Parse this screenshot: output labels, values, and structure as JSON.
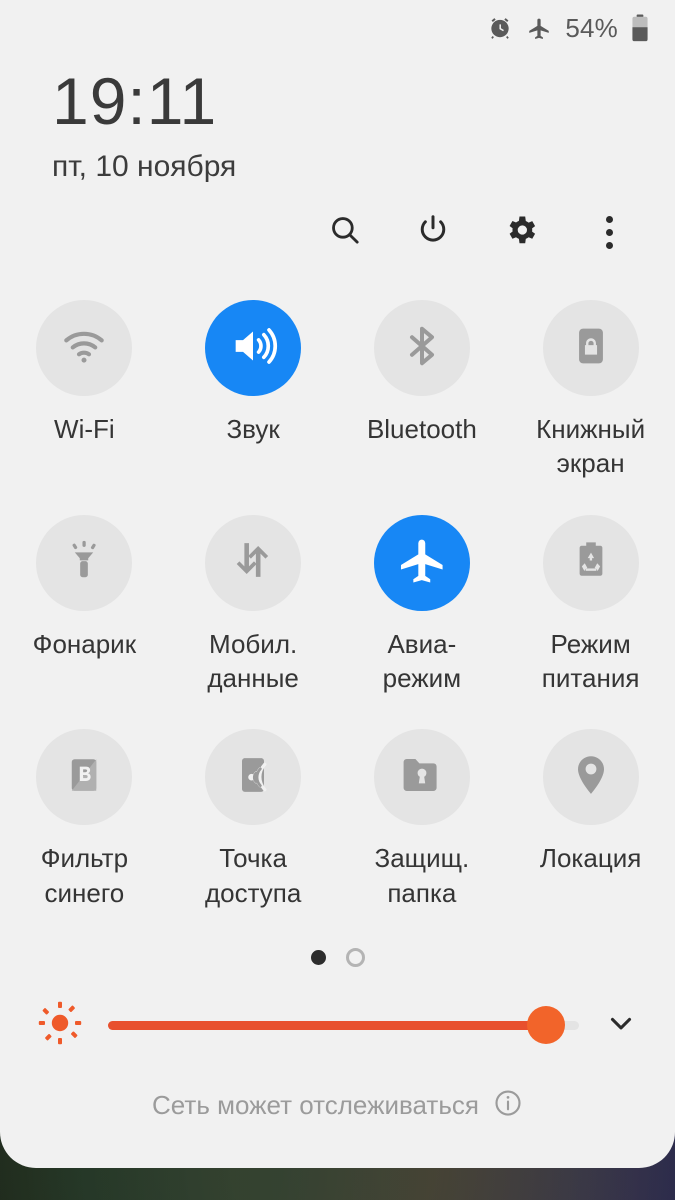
{
  "statusbar": {
    "alarm_icon": "alarm-icon",
    "airplane_icon": "airplane-icon",
    "battery_percent": "54%",
    "battery_icon": "battery-icon"
  },
  "clock": {
    "time": "19:11",
    "date": "пт, 10 ноября"
  },
  "actions": {
    "search": "search-icon",
    "power": "power-icon",
    "settings": "gear-icon",
    "more": "more-vertical-icon"
  },
  "tiles": [
    {
      "label": "Wi-Fi",
      "icon": "wifi-icon",
      "active": false
    },
    {
      "label": "Звук",
      "icon": "volume-icon",
      "active": true
    },
    {
      "label": "Bluetooth",
      "icon": "bluetooth-icon",
      "active": false
    },
    {
      "label": "Книжный\nэкран",
      "icon": "rotation-lock-icon",
      "active": false
    },
    {
      "label": "Фонарик",
      "icon": "flashlight-icon",
      "active": false
    },
    {
      "label": "Мобил.\nданные",
      "icon": "mobile-data-icon",
      "active": false
    },
    {
      "label": "Авиа-\nрежим",
      "icon": "airplane-icon",
      "active": true
    },
    {
      "label": "Режим\nпитания",
      "icon": "power-mode-icon",
      "active": false
    },
    {
      "label": "Фильтр\nсинего",
      "icon": "blue-filter-icon",
      "active": false
    },
    {
      "label": "Точка\nдоступа",
      "icon": "hotspot-icon",
      "active": false
    },
    {
      "label": "Защищ.\nпапка",
      "icon": "secure-folder-icon",
      "active": false
    },
    {
      "label": "Локация",
      "icon": "location-pin-icon",
      "active": false
    }
  ],
  "pager": {
    "pages": 2,
    "current": 1
  },
  "brightness": {
    "value": 93,
    "sun_icon": "brightness-sun-icon",
    "expand_icon": "chevron-down-icon"
  },
  "footer": {
    "text": "Сеть может отслеживаться",
    "info_icon": "info-icon"
  },
  "colors": {
    "accent_active": "#1787f5",
    "slider": "#e8502e",
    "panel_bg": "#f1f1f1",
    "tile_off": "#e4e4e4",
    "icon_off": "#9a9a9a"
  }
}
